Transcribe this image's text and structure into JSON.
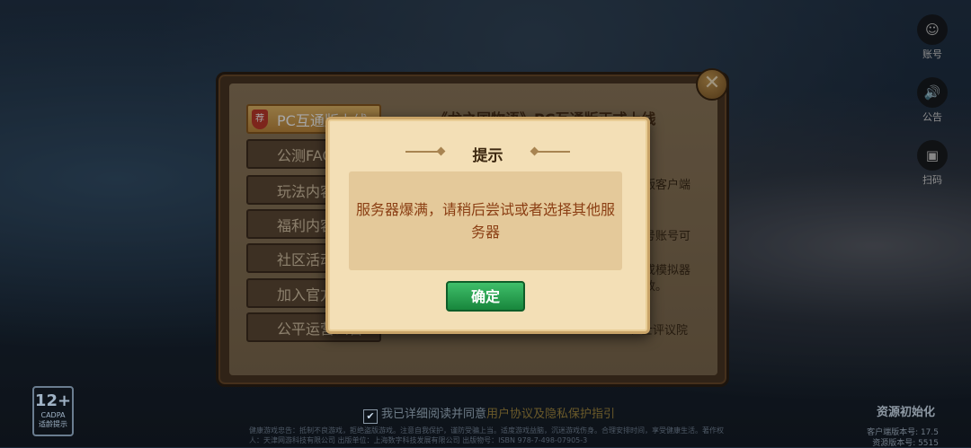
{
  "side": {
    "items": [
      {
        "label": "账号",
        "icon": "account-icon"
      },
      {
        "label": "公告",
        "icon": "notice-icon"
      },
      {
        "label": "扫码",
        "icon": "scan-icon"
      }
    ]
  },
  "board": {
    "tabs": [
      "PC互通版上线",
      "公测FAQ",
      "玩法内容",
      "福利内容",
      "社区活动",
      "加入官方",
      "公平运营公告"
    ],
    "title": "《龙之国物语》PC互通版正式上线",
    "lines": [
      "版客户端",
      "号账号可",
      "或模拟器",
      "放。",
      "、士评议院"
    ],
    "recommend_badge": "荐"
  },
  "modal": {
    "title": "提示",
    "message": "服务器爆满，请稍后尝试或者选择其他服务器",
    "confirm": "确定"
  },
  "bottom": {
    "age_rating": "12+",
    "age_caption": "CADPA",
    "age_caption2": "适龄提示",
    "agree_text": "我已详细阅读并同意",
    "agree_link": "用户协议及隐私保护指引",
    "footer": "健康游戏忠告：抵制不良游戏，拒绝盗版游戏。注意自我保护，谨防受骗上当。适度游戏益脑，沉迷游戏伤身。合理安排时间，享受健康生活。著作权人：天津网游科技有限公司  出版单位：上海数字科技发展有限公司  出版物号：ISBN 978-7-498-07905-3",
    "resource_init": "资源初始化",
    "client_version": "客户端版本号: 17.5",
    "resource_version": "资源版本号: 5515"
  }
}
